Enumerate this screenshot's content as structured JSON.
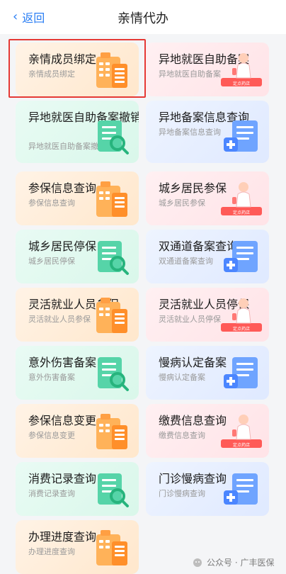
{
  "header": {
    "back_label": "返回",
    "title": "亲情代办"
  },
  "cards": [
    {
      "name": "亲情成员绑定",
      "sub": "亲情成员绑定",
      "icon": "building-icon",
      "theme": "orange"
    },
    {
      "name": "异地就医自助备案",
      "sub": "异地就医自助备案",
      "icon": "pharmacy-icon",
      "theme": "pink"
    },
    {
      "name": "异地就医自助备案撤销",
      "sub": "异地就医自助备案撤销",
      "icon": "magnifier-doc-icon",
      "theme": "green"
    },
    {
      "name": "异地备案信息查询",
      "sub": "异地备案信息查询",
      "icon": "medical-doc-icon",
      "theme": "blue"
    },
    {
      "name": "参保信息查询",
      "sub": "参保信息查询",
      "icon": "building-icon",
      "theme": "orange"
    },
    {
      "name": "城乡居民参保",
      "sub": "城乡居民参保",
      "icon": "pharmacy-icon",
      "theme": "pink"
    },
    {
      "name": "城乡居民停保",
      "sub": "城乡居民停保",
      "icon": "magnifier-doc-icon",
      "theme": "green"
    },
    {
      "name": "双通道备案查询",
      "sub": "双通道备案查询",
      "icon": "medical-doc-icon",
      "theme": "blue"
    },
    {
      "name": "灵活就业人员参保",
      "sub": "灵活就业人员参保",
      "icon": "building-icon",
      "theme": "orange"
    },
    {
      "name": "灵活就业人员停保",
      "sub": "灵活就业人员停保",
      "icon": "pharmacy-icon",
      "theme": "pink"
    },
    {
      "name": "意外伤害备案",
      "sub": "意外伤害备案",
      "icon": "magnifier-doc-icon",
      "theme": "green"
    },
    {
      "name": "慢病认定备案",
      "sub": "慢病认定备案",
      "icon": "medical-doc-icon",
      "theme": "blue"
    },
    {
      "name": "参保信息变更",
      "sub": "参保信息变更",
      "icon": "building-icon",
      "theme": "orange"
    },
    {
      "name": "缴费信息查询",
      "sub": "缴费信息查询",
      "icon": "pharmacy-icon",
      "theme": "pink"
    },
    {
      "name": "消费记录查询",
      "sub": "消费记录查询",
      "icon": "magnifier-doc-icon",
      "theme": "green"
    },
    {
      "name": "门诊慢病查询",
      "sub": "门诊慢病查询",
      "icon": "medical-doc-icon",
      "theme": "blue"
    },
    {
      "name": "办理进度查询",
      "sub": "办理进度查询",
      "icon": "building-icon",
      "theme": "orange"
    }
  ],
  "pharmacy_sign": "定点药店",
  "watermark": "公众号 · 广丰医保"
}
